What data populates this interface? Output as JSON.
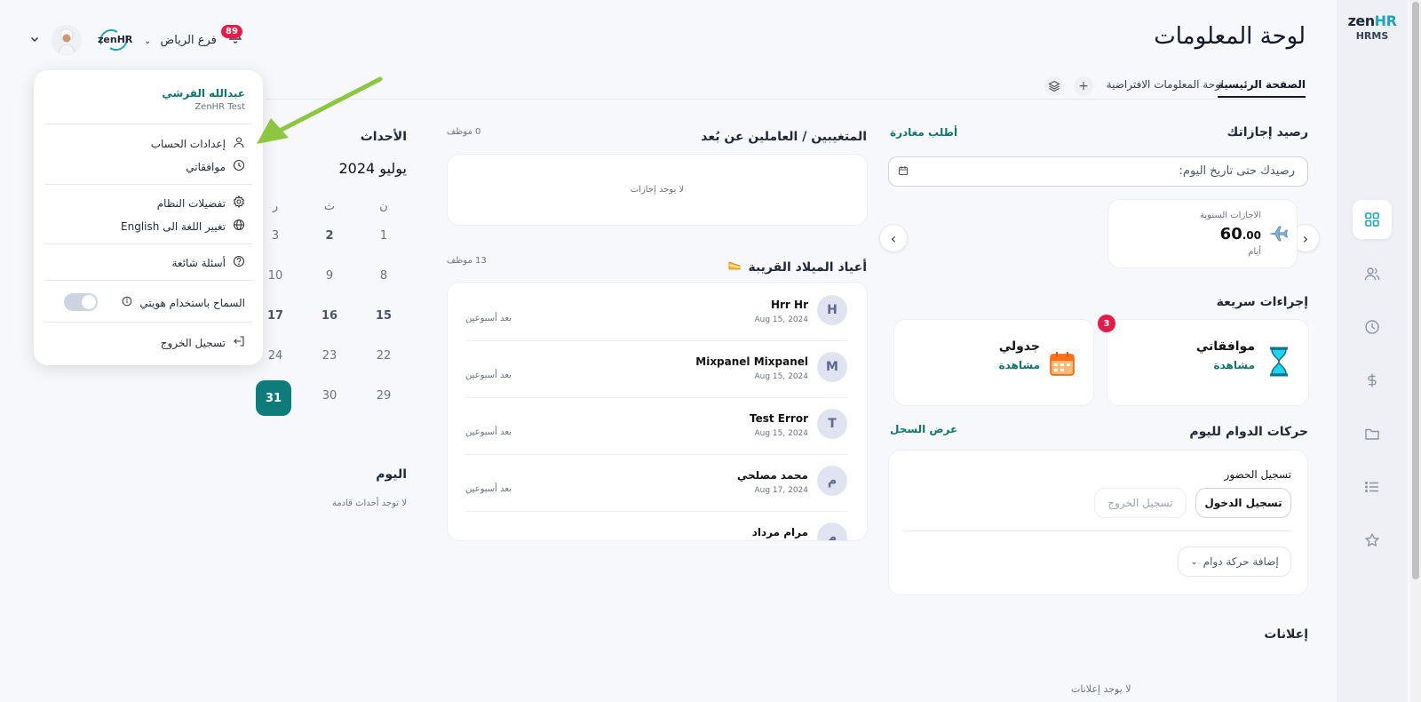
{
  "app": {
    "logo_zen": "zen",
    "logo_hr": "HR",
    "logo_sub": "HRMS",
    "header_logo": "zenHR"
  },
  "header": {
    "title": "لوحة المعلومات",
    "notification_count": "89",
    "branch": "فرع الرياض"
  },
  "tabs": {
    "home": "الصفحة الرئيسية",
    "default_dashboard": "لوحة المعلومات الافتراضية"
  },
  "leave_balance": {
    "title": "رصيد إجازاتك",
    "request_link": "أطلب مغادرة",
    "date_placeholder": "رصيدك حتى تاريخ اليوم:",
    "card_label": "الاجازات السنوية",
    "card_value": "60",
    "card_decimals": ".00",
    "card_unit": "أيام"
  },
  "quick_actions": {
    "title": "إجراءات سريعة",
    "approvals_label": "موافقاتي",
    "approvals_link": "مشاهدة",
    "approvals_badge": "3",
    "schedule_label": "جدولي",
    "schedule_link": "مشاهدة"
  },
  "attendance": {
    "title": "حركات الدوام لليوم",
    "history_link": "عرض السجل",
    "subtitle": "تسجيل الحضور",
    "check_in": "تسجيل الدخول",
    "check_out": "تسجيل الخروج",
    "add_movement": "إضافة حركة دوام"
  },
  "announcements": {
    "title": "إعلانات",
    "empty": "لا يوجد إعلانات"
  },
  "absentees": {
    "title": "المتغيبين / العاملين عن بُعد",
    "count": "0 موظف",
    "empty": "لا يوجد إجازات"
  },
  "birthdays": {
    "title": "أعياد الميلاد القريبة",
    "count": "13 موظف",
    "items": [
      {
        "initial": "H",
        "name": "Hrr Hr",
        "date": "Aug 15, 2024",
        "rel": "بعد أسبوعين"
      },
      {
        "initial": "M",
        "name": "Mixpanel Mixpanel",
        "date": "Aug 15, 2024",
        "rel": "بعد أسبوعين"
      },
      {
        "initial": "T",
        "name": "Test Error",
        "date": "Aug 15, 2024",
        "rel": "بعد أسبوعين"
      },
      {
        "initial": "م",
        "name": "محمد مصلحي",
        "date": "Aug 17, 2024",
        "rel": "بعد أسبوعين"
      },
      {
        "initial": "م",
        "name": "مرام مرداد",
        "date": "",
        "rel": ""
      }
    ]
  },
  "events": {
    "title": "الأحداث",
    "month": "يوليو 2024",
    "weekdays": [
      "ن",
      "ث",
      "ر"
    ],
    "weeks": [
      [
        "1",
        "2",
        "3"
      ],
      [
        "8",
        "9",
        "10"
      ],
      [
        "15",
        "16",
        "17"
      ],
      [
        "22",
        "23",
        "24"
      ],
      [
        "29",
        "30",
        "31"
      ]
    ],
    "today_day": "31",
    "today_title": "اليوم",
    "today_empty": "لا توجد أحداث قادمة"
  },
  "user_menu": {
    "name": "عبدالله القرشي",
    "company": "ZenHR Test",
    "items": {
      "account_settings": "إعدادات الحساب",
      "my_approvals": "موافقاتي",
      "system_preferences": "تفضيلات النظام",
      "change_language": "تغيير اللغة الى English",
      "faq": "أسئلة شائعة",
      "allow_identity": "السماح باستخدام هويتي",
      "logout": "تسجيل الخروج"
    }
  },
  "colors": {
    "teal": "#0f766e",
    "accent_teal": "#1aa6b7",
    "badge_red": "#e11d48",
    "arrow_green": "#8dc63f",
    "today_teal": "#0e7c7b"
  }
}
